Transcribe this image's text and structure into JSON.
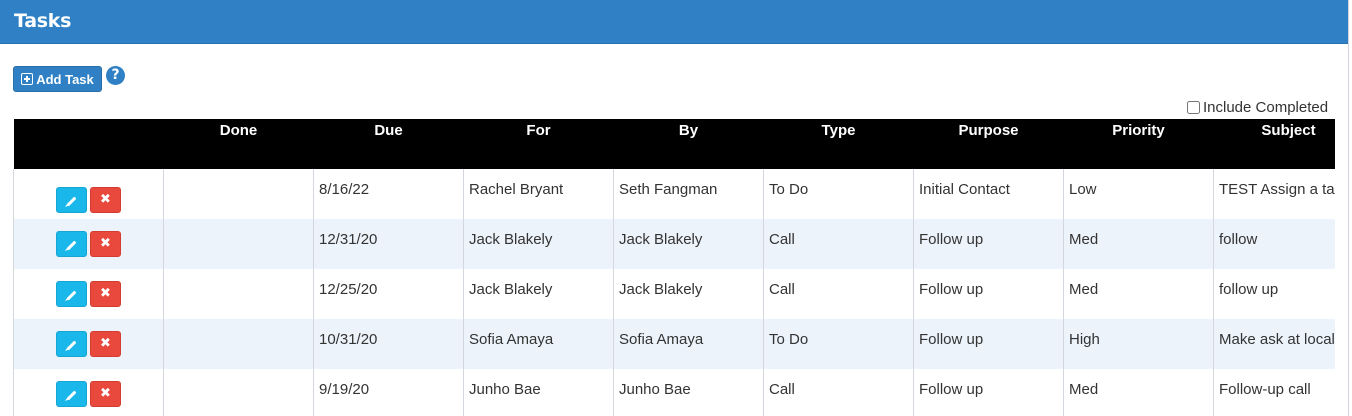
{
  "header": {
    "title": "Tasks"
  },
  "toolbar": {
    "add_task_label": "Add Task",
    "help_label": "?",
    "include_completed_label": "Include Completed",
    "include_completed_checked": false
  },
  "table": {
    "columns": [
      "",
      "Done",
      "Due",
      "For",
      "By",
      "Type",
      "Purpose",
      "Priority",
      "Subject"
    ],
    "rows": [
      {
        "done": "",
        "due": "8/16/22",
        "for": "Rachel Bryant",
        "by": "Seth Fangman",
        "type": "To Do",
        "purpose": "Initial Contact",
        "priority": "Low",
        "subject": "TEST Assign a task"
      },
      {
        "done": "",
        "due": "12/31/20",
        "for": "Jack Blakely",
        "by": "Jack Blakely",
        "type": "Call",
        "purpose": "Follow up",
        "priority": "Med",
        "subject": "follow"
      },
      {
        "done": "",
        "due": "12/25/20",
        "for": "Jack Blakely",
        "by": "Jack Blakely",
        "type": "Call",
        "purpose": "Follow up",
        "priority": "Med",
        "subject": "follow up"
      },
      {
        "done": "",
        "due": "10/31/20",
        "for": "Sofia Amaya",
        "by": "Sofia Amaya",
        "type": "To Do",
        "purpose": "Follow up",
        "priority": "High",
        "subject": "Make ask at local"
      },
      {
        "done": "",
        "due": "9/19/20",
        "for": "Junho Bae",
        "by": "Junho Bae",
        "type": "Call",
        "purpose": "Follow up",
        "priority": "Med",
        "subject": "Follow-up call"
      }
    ]
  },
  "colors": {
    "header_bg": "#2f80c4",
    "edit_button": "#1ab8ea",
    "delete_button": "#e8493c",
    "row_alt": "#edf3fb"
  },
  "icons": [
    "plus-box-icon",
    "help-icon",
    "pencil-icon",
    "x-icon"
  ]
}
